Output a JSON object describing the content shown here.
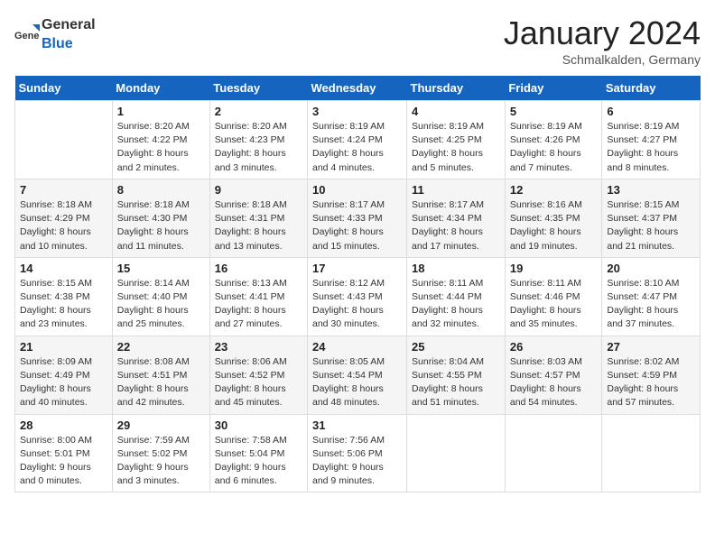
{
  "header": {
    "logo_general": "General",
    "logo_blue": "Blue",
    "title": "January 2024",
    "location": "Schmalkalden, Germany"
  },
  "weekdays": [
    "Sunday",
    "Monday",
    "Tuesday",
    "Wednesday",
    "Thursday",
    "Friday",
    "Saturday"
  ],
  "weeks": [
    [
      {
        "day": "",
        "sunrise": "",
        "sunset": "",
        "daylight": ""
      },
      {
        "day": "1",
        "sunrise": "Sunrise: 8:20 AM",
        "sunset": "Sunset: 4:22 PM",
        "daylight": "Daylight: 8 hours and 2 minutes."
      },
      {
        "day": "2",
        "sunrise": "Sunrise: 8:20 AM",
        "sunset": "Sunset: 4:23 PM",
        "daylight": "Daylight: 8 hours and 3 minutes."
      },
      {
        "day": "3",
        "sunrise": "Sunrise: 8:19 AM",
        "sunset": "Sunset: 4:24 PM",
        "daylight": "Daylight: 8 hours and 4 minutes."
      },
      {
        "day": "4",
        "sunrise": "Sunrise: 8:19 AM",
        "sunset": "Sunset: 4:25 PM",
        "daylight": "Daylight: 8 hours and 5 minutes."
      },
      {
        "day": "5",
        "sunrise": "Sunrise: 8:19 AM",
        "sunset": "Sunset: 4:26 PM",
        "daylight": "Daylight: 8 hours and 7 minutes."
      },
      {
        "day": "6",
        "sunrise": "Sunrise: 8:19 AM",
        "sunset": "Sunset: 4:27 PM",
        "daylight": "Daylight: 8 hours and 8 minutes."
      }
    ],
    [
      {
        "day": "7",
        "sunrise": "Sunrise: 8:18 AM",
        "sunset": "Sunset: 4:29 PM",
        "daylight": "Daylight: 8 hours and 10 minutes."
      },
      {
        "day": "8",
        "sunrise": "Sunrise: 8:18 AM",
        "sunset": "Sunset: 4:30 PM",
        "daylight": "Daylight: 8 hours and 11 minutes."
      },
      {
        "day": "9",
        "sunrise": "Sunrise: 8:18 AM",
        "sunset": "Sunset: 4:31 PM",
        "daylight": "Daylight: 8 hours and 13 minutes."
      },
      {
        "day": "10",
        "sunrise": "Sunrise: 8:17 AM",
        "sunset": "Sunset: 4:33 PM",
        "daylight": "Daylight: 8 hours and 15 minutes."
      },
      {
        "day": "11",
        "sunrise": "Sunrise: 8:17 AM",
        "sunset": "Sunset: 4:34 PM",
        "daylight": "Daylight: 8 hours and 17 minutes."
      },
      {
        "day": "12",
        "sunrise": "Sunrise: 8:16 AM",
        "sunset": "Sunset: 4:35 PM",
        "daylight": "Daylight: 8 hours and 19 minutes."
      },
      {
        "day": "13",
        "sunrise": "Sunrise: 8:15 AM",
        "sunset": "Sunset: 4:37 PM",
        "daylight": "Daylight: 8 hours and 21 minutes."
      }
    ],
    [
      {
        "day": "14",
        "sunrise": "Sunrise: 8:15 AM",
        "sunset": "Sunset: 4:38 PM",
        "daylight": "Daylight: 8 hours and 23 minutes."
      },
      {
        "day": "15",
        "sunrise": "Sunrise: 8:14 AM",
        "sunset": "Sunset: 4:40 PM",
        "daylight": "Daylight: 8 hours and 25 minutes."
      },
      {
        "day": "16",
        "sunrise": "Sunrise: 8:13 AM",
        "sunset": "Sunset: 4:41 PM",
        "daylight": "Daylight: 8 hours and 27 minutes."
      },
      {
        "day": "17",
        "sunrise": "Sunrise: 8:12 AM",
        "sunset": "Sunset: 4:43 PM",
        "daylight": "Daylight: 8 hours and 30 minutes."
      },
      {
        "day": "18",
        "sunrise": "Sunrise: 8:11 AM",
        "sunset": "Sunset: 4:44 PM",
        "daylight": "Daylight: 8 hours and 32 minutes."
      },
      {
        "day": "19",
        "sunrise": "Sunrise: 8:11 AM",
        "sunset": "Sunset: 4:46 PM",
        "daylight": "Daylight: 8 hours and 35 minutes."
      },
      {
        "day": "20",
        "sunrise": "Sunrise: 8:10 AM",
        "sunset": "Sunset: 4:47 PM",
        "daylight": "Daylight: 8 hours and 37 minutes."
      }
    ],
    [
      {
        "day": "21",
        "sunrise": "Sunrise: 8:09 AM",
        "sunset": "Sunset: 4:49 PM",
        "daylight": "Daylight: 8 hours and 40 minutes."
      },
      {
        "day": "22",
        "sunrise": "Sunrise: 8:08 AM",
        "sunset": "Sunset: 4:51 PM",
        "daylight": "Daylight: 8 hours and 42 minutes."
      },
      {
        "day": "23",
        "sunrise": "Sunrise: 8:06 AM",
        "sunset": "Sunset: 4:52 PM",
        "daylight": "Daylight: 8 hours and 45 minutes."
      },
      {
        "day": "24",
        "sunrise": "Sunrise: 8:05 AM",
        "sunset": "Sunset: 4:54 PM",
        "daylight": "Daylight: 8 hours and 48 minutes."
      },
      {
        "day": "25",
        "sunrise": "Sunrise: 8:04 AM",
        "sunset": "Sunset: 4:55 PM",
        "daylight": "Daylight: 8 hours and 51 minutes."
      },
      {
        "day": "26",
        "sunrise": "Sunrise: 8:03 AM",
        "sunset": "Sunset: 4:57 PM",
        "daylight": "Daylight: 8 hours and 54 minutes."
      },
      {
        "day": "27",
        "sunrise": "Sunrise: 8:02 AM",
        "sunset": "Sunset: 4:59 PM",
        "daylight": "Daylight: 8 hours and 57 minutes."
      }
    ],
    [
      {
        "day": "28",
        "sunrise": "Sunrise: 8:00 AM",
        "sunset": "Sunset: 5:01 PM",
        "daylight": "Daylight: 9 hours and 0 minutes."
      },
      {
        "day": "29",
        "sunrise": "Sunrise: 7:59 AM",
        "sunset": "Sunset: 5:02 PM",
        "daylight": "Daylight: 9 hours and 3 minutes."
      },
      {
        "day": "30",
        "sunrise": "Sunrise: 7:58 AM",
        "sunset": "Sunset: 5:04 PM",
        "daylight": "Daylight: 9 hours and 6 minutes."
      },
      {
        "day": "31",
        "sunrise": "Sunrise: 7:56 AM",
        "sunset": "Sunset: 5:06 PM",
        "daylight": "Daylight: 9 hours and 9 minutes."
      },
      {
        "day": "",
        "sunrise": "",
        "sunset": "",
        "daylight": ""
      },
      {
        "day": "",
        "sunrise": "",
        "sunset": "",
        "daylight": ""
      },
      {
        "day": "",
        "sunrise": "",
        "sunset": "",
        "daylight": ""
      }
    ]
  ]
}
